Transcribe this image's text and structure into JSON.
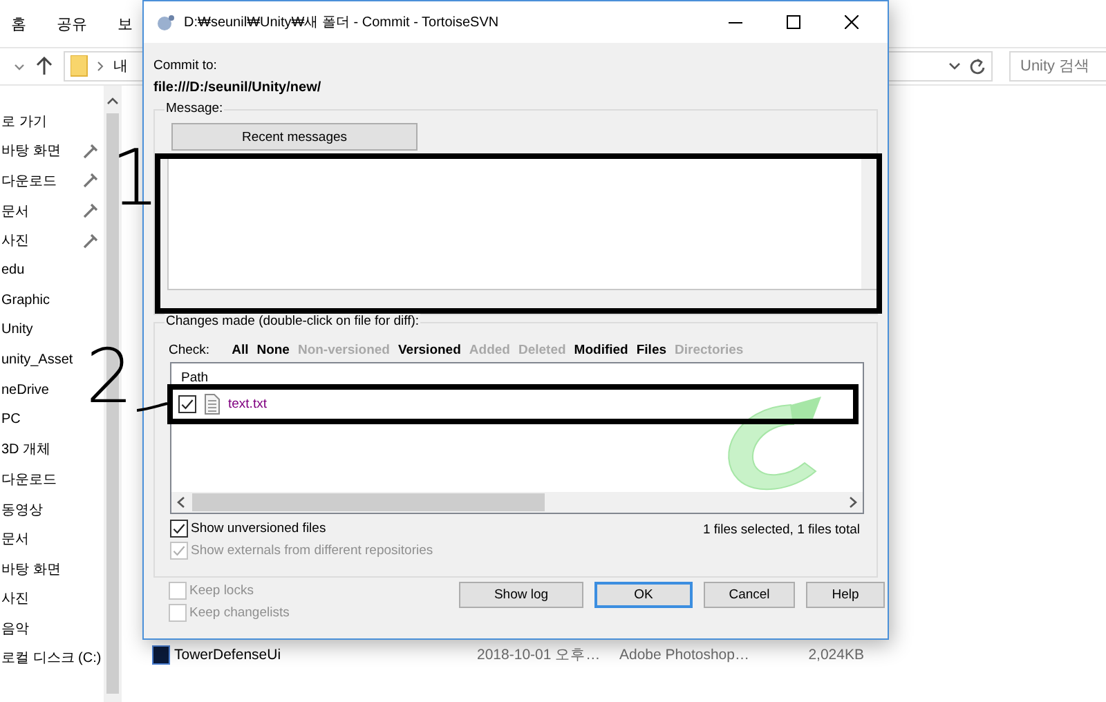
{
  "explorer": {
    "ribbon_tabs": [
      "홈",
      "공유",
      "보"
    ],
    "address_path": "내",
    "search": {
      "placeholder": "Unity 검색"
    },
    "sidebar": [
      {
        "label": "로 가기",
        "pinned": false
      },
      {
        "label": "바탕 화면",
        "pinned": true
      },
      {
        "label": "다운로드",
        "pinned": true
      },
      {
        "label": "문서",
        "pinned": true
      },
      {
        "label": "사진",
        "pinned": true
      },
      {
        "label": "edu",
        "pinned": false
      },
      {
        "label": "Graphic",
        "pinned": false
      },
      {
        "label": "Unity",
        "pinned": false
      },
      {
        "label": "unity_Asset",
        "pinned": false
      },
      {
        "label": "neDrive",
        "pinned": false
      },
      {
        "label": "PC",
        "pinned": false
      },
      {
        "label": "3D 개체",
        "pinned": false
      },
      {
        "label": "다운로드",
        "pinned": false
      },
      {
        "label": "동영상",
        "pinned": false
      },
      {
        "label": "문서",
        "pinned": false
      },
      {
        "label": "바탕 화면",
        "pinned": false
      },
      {
        "label": "사진",
        "pinned": false
      },
      {
        "label": "음악",
        "pinned": false
      },
      {
        "label": "로컬 디스크 (C:)",
        "pinned": false
      }
    ],
    "files": [
      {
        "name": "TowerDefenseUi",
        "modified": "2018-10-01 오후…",
        "type": "Adobe Photoshop…",
        "size": "2,024KB"
      }
    ]
  },
  "dialog": {
    "title": "D:₩seunil₩Unity₩새 폴더 - Commit - TortoiseSVN",
    "commit_to_label": "Commit to:",
    "url": "file:///D:/seunil/Unity/new/",
    "message_group": "Message:",
    "recent_button": "Recent messages",
    "changes_group": "Changes made (double-click on file for diff):",
    "check_label": "Check:",
    "check_filters": [
      {
        "label": "All",
        "enabled": true
      },
      {
        "label": "None",
        "enabled": true
      },
      {
        "label": "Non-versioned",
        "enabled": false
      },
      {
        "label": "Versioned",
        "enabled": true
      },
      {
        "label": "Added",
        "enabled": false
      },
      {
        "label": "Deleted",
        "enabled": false
      },
      {
        "label": "Modified",
        "enabled": true
      },
      {
        "label": "Files",
        "enabled": true
      },
      {
        "label": "Directories",
        "enabled": false
      }
    ],
    "columns": [
      "Path"
    ],
    "files": [
      {
        "path": "text.txt",
        "checked": true
      }
    ],
    "options": [
      {
        "label": "Show unversioned files",
        "checked": true,
        "disabled": false
      },
      {
        "label": "Show externals from different repositories",
        "checked": true,
        "disabled": true
      }
    ],
    "selection_summary": "1 files selected, 1 files total",
    "keep_options": [
      {
        "label": "Keep locks",
        "checked": false,
        "disabled": true
      },
      {
        "label": "Keep changelists",
        "checked": false,
        "disabled": true
      }
    ],
    "buttons": [
      {
        "label": "Show log",
        "default": false
      },
      {
        "label": "OK",
        "default": true
      },
      {
        "label": "Cancel",
        "default": false
      },
      {
        "label": "Help",
        "default": false
      }
    ]
  },
  "annotations": [
    {
      "kind": "box"
    },
    {
      "kind": "box"
    },
    {
      "kind": "number",
      "label": "1"
    },
    {
      "kind": "number",
      "label": "2"
    }
  ]
}
